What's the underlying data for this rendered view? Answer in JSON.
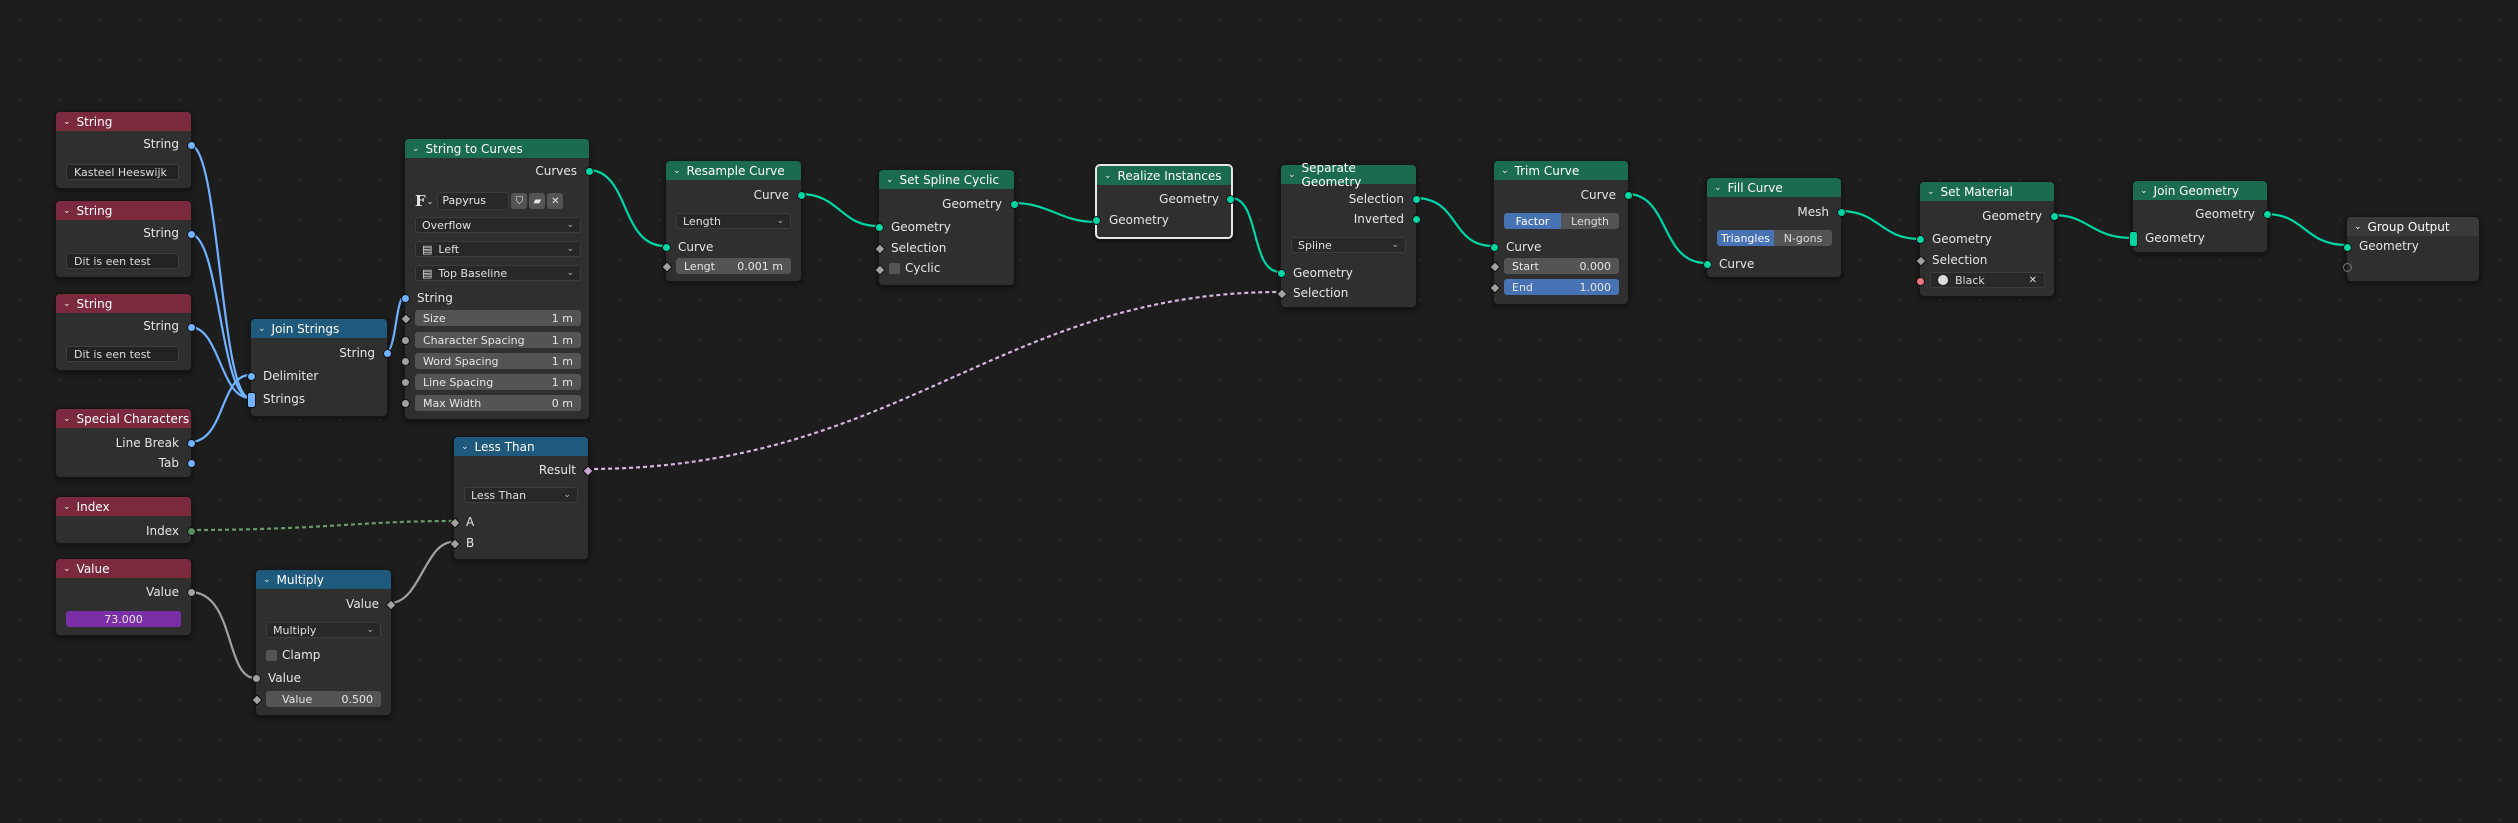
{
  "editor": "Geometry Nodes",
  "nodes": {
    "string1": {
      "title": "String",
      "output": "String",
      "value": "Kasteel Heeswijk"
    },
    "string2": {
      "title": "String",
      "output": "String",
      "value": "Dit is een test"
    },
    "string3": {
      "title": "String",
      "output": "String",
      "value": "Dit is een test"
    },
    "special": {
      "title": "Special Characters",
      "out1": "Line Break",
      "out2": "Tab"
    },
    "index": {
      "title": "Index",
      "output": "Index"
    },
    "value": {
      "title": "Value",
      "output": "Value",
      "value": "73.000"
    },
    "join_strings": {
      "title": "Join Strings",
      "output": "String",
      "in1": "Delimiter",
      "in2": "Strings"
    },
    "string_to_curves": {
      "title": "String to Curves",
      "output": "Curves",
      "font": "Papyrus R...",
      "overflow": "Overflow",
      "align_x": "Left",
      "align_y": "Top Baseline",
      "in_string": "String",
      "size_label": "Size",
      "size_value": "1 m",
      "char_label": "Character Spacing",
      "char_value": "1 m",
      "word_label": "Word Spacing",
      "word_value": "1 m",
      "line_label": "Line Spacing",
      "line_value": "1 m",
      "maxw_label": "Max Width",
      "maxw_value": "0 m"
    },
    "less_than": {
      "title": "Less Than",
      "output": "Result",
      "mode": "Less Than",
      "in1": "A",
      "in2": "B"
    },
    "multiply": {
      "title": "Multiply",
      "output": "Value",
      "mode": "Multiply",
      "clamp": "Clamp",
      "in1": "Value",
      "in2_label": "Value",
      "in2_value": "0.500"
    },
    "resample": {
      "title": "Resample Curve",
      "output": "Curve",
      "mode": "Length",
      "in1": "Curve",
      "len_label": "Lengt",
      "len_value": "0.001 m"
    },
    "spline_cyclic": {
      "title": "Set Spline Cyclic",
      "output": "Geometry",
      "in1": "Geometry",
      "in2": "Selection",
      "in3": "Cyclic"
    },
    "realize": {
      "title": "Realize Instances",
      "output": "Geometry",
      "in1": "Geometry"
    },
    "separate": {
      "title": "Separate Geometry",
      "out1": "Selection",
      "out2": "Inverted",
      "domain": "Spline",
      "in1": "Geometry",
      "in2": "Selection"
    },
    "trim": {
      "title": "Trim Curve",
      "output": "Curve",
      "seg_on": "Factor",
      "seg_off": "Length",
      "in1": "Curve",
      "start_label": "Start",
      "start_value": "0.000",
      "end_label": "End",
      "end_value": "1.000"
    },
    "fill": {
      "title": "Fill Curve",
      "output": "Mesh",
      "seg_on": "Triangles",
      "seg_off": "N-gons",
      "in1": "Curve"
    },
    "material": {
      "title": "Set Material",
      "output": "Geometry",
      "in1": "Geometry",
      "in2": "Selection",
      "material": "Black"
    },
    "join_geo": {
      "title": "Join Geometry",
      "output": "Geometry",
      "in1": "Geometry"
    },
    "group_out": {
      "title": "Group Output",
      "in1": "Geometry"
    }
  },
  "colors": {
    "string_socket": "#70b2ff",
    "geometry_socket": "#00d6a3",
    "float_socket": "#a1a1a1",
    "bool_socket": "#cca6d6",
    "int_socket": "#598c5c",
    "input_header": "#7b2a3d",
    "geometry_header": "#1b6b4e",
    "converter_header": "#1f5a7c"
  }
}
